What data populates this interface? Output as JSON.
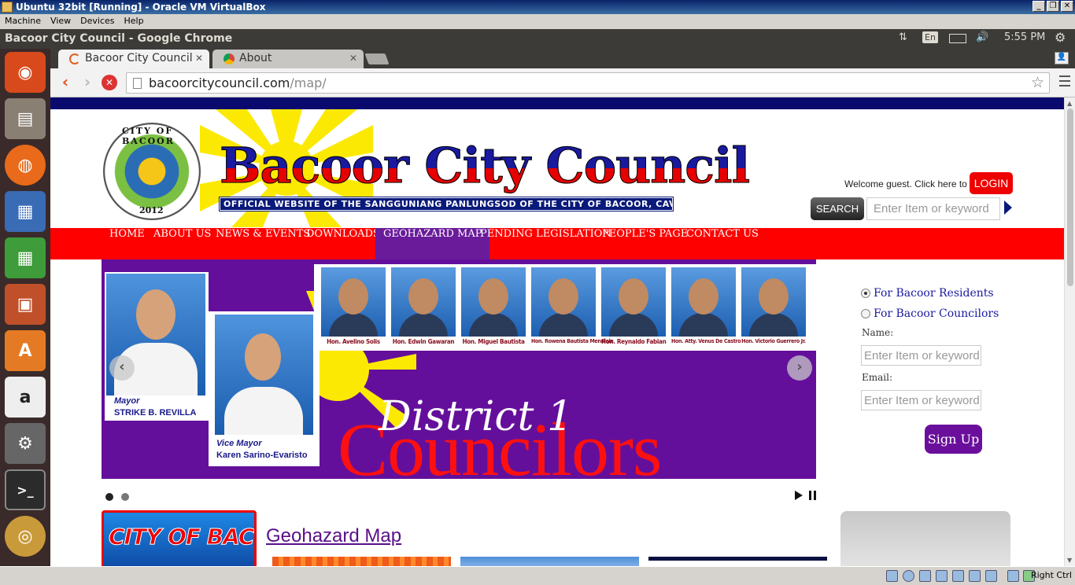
{
  "vbox": {
    "title": "Ubuntu 32bit [Running] - Oracle VM VirtualBox",
    "menu": [
      "Machine",
      "View",
      "Devices",
      "Help"
    ],
    "host_key": "Right Ctrl"
  },
  "ubuntu_panel": {
    "window_title": "Bacoor City Council - Google Chrome",
    "keyboard_layout": "En",
    "clock": "5:55 PM"
  },
  "launcher": {
    "apps": [
      "ubuntu-dash",
      "files",
      "firefox",
      "libreoffice-writer",
      "libreoffice-calc",
      "libreoffice-impress",
      "ubuntu-software-center",
      "amazon",
      "system-settings",
      "terminal",
      "chrome"
    ]
  },
  "browser": {
    "tabs": [
      {
        "label": "Bacoor City Council",
        "active": true
      },
      {
        "label": "About",
        "active": false
      }
    ],
    "url_host": "bacoorcitycouncil.com",
    "url_path": "/map/"
  },
  "site": {
    "seal_top": "CITY OF BACOOR",
    "seal_year": "2012",
    "brand": "Bacoor City Council",
    "tagline": "OFFICIAL WEBSITE OF THE SANGGUNIANG PANLUNGSOD OF THE CITY OF BACOOR, CAVITE",
    "welcome": "Welcome guest. Click here to",
    "login": "LOGIN",
    "search_btn": "SEARCH",
    "search_placeholder": "Enter Item or keyword",
    "nav": [
      "HOME",
      "ABOUT US",
      "NEWS & EVENTS",
      "DOWNLOADS",
      "GEOHAZARD MAP",
      "PENDING LEGISLATION",
      "PEOPLE'S PAGE",
      "CONTACT US"
    ],
    "nav_active": "GEOHAZARD MAP"
  },
  "slide": {
    "mayor_role": "Mayor",
    "mayor_name": "STRIKE B. REVILLA",
    "vice_role": "Vice Mayor",
    "vice_name": "Karen Sarino-Evaristo",
    "councilors": [
      "Hon. Avelino Solis",
      "Hon. Edwin Gawaran",
      "Hon. Miguel Bautista",
      "Hon. Rowena Bautista Mendiola",
      "Hon. Reynaldo Fabian",
      "Hon. Atty. Venus De Castro",
      "Hon. Victorio Guerrero Jr."
    ],
    "district": "District 1",
    "councilors_word": "Councilors",
    "slide_count": 2,
    "current_slide": 1
  },
  "sidebar_form": {
    "option_residents": "For Bacoor Residents",
    "option_councilors": "For Bacoor Councilors",
    "selected": "For Bacoor Residents",
    "name_label": "Name:",
    "name_placeholder": "Enter Item or keyword",
    "email_label": "Email:",
    "email_placeholder": "Enter Item or keyword",
    "signup": "Sign Up"
  },
  "content": {
    "logo_text": "CITY OF BACOOR",
    "page_title": "Geohazard Map"
  },
  "colors": {
    "nav_red": "#ff0000",
    "accent_purple": "#6a1b9a",
    "navy": "#0a0a6e"
  }
}
